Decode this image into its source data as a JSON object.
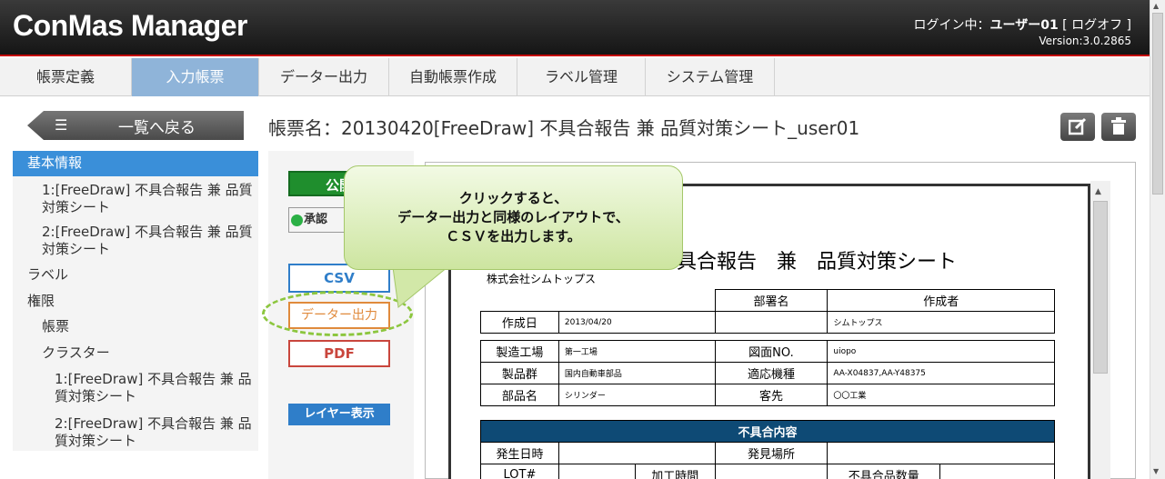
{
  "app": {
    "title": "ConMas Manager",
    "login_text": "ログイン中：",
    "user": "ユーザー01",
    "logout": "[ ログオフ ]",
    "version": "Version:3.0.2865"
  },
  "tabs": [
    "帳票定義",
    "入力帳票",
    "データー出力",
    "自動帳票作成",
    "ラベル管理",
    "システム管理"
  ],
  "back_label": "一覧へ戻る",
  "form_title": "帳票名：20130420[FreeDraw] 不具合報告 兼 品質対策シート_user01",
  "sidebar": {
    "basic": "基本情報",
    "sheet1": [
      "1:[FreeDraw] 不具合報告 兼 品質",
      "対策シート"
    ],
    "sheet2": [
      "2:[FreeDraw] 不具合報告 兼 品質",
      "対策シート"
    ],
    "label": "ラベル",
    "permission": "権限",
    "form": "帳票",
    "cluster": "クラスター",
    "c_sheet1": [
      "1:[FreeDraw] 不具合報告 兼 品",
      "質対策シート"
    ],
    "c_sheet2": [
      "2:[FreeDraw] 不具合報告 兼 品",
      "質対策シート"
    ]
  },
  "buttons": {
    "publish": "公開",
    "approve": "承認",
    "csv": "CSV",
    "data_output": "データー出力",
    "pdf": "PDF",
    "layer": "レイヤー表示"
  },
  "callout": [
    "クリックすると、",
    "データー出力と同様のレイアウトで、",
    "ＣＳＶを出力します。"
  ],
  "document": {
    "title": "不具合報告　兼　品質対策シート",
    "company": "株式会社シムトップス",
    "dept_label": "部署名",
    "author_label": "作成者",
    "date_label": "作成日",
    "date_value": "2013/04/20",
    "author_value": "シムトップス",
    "factory_label": "製造工場",
    "factory_value": "第一工場",
    "drawing_label": "図面NO.",
    "drawing_value": "uiopo",
    "group_label": "製品群",
    "group_value": "国内自動車部品",
    "model_label": "適応機種",
    "model_value": "AA-X04837,AA-Y48375",
    "part_label": "部品名",
    "part_value": "シリンダー",
    "customer_label": "客先",
    "customer_value": "〇〇工業",
    "defect_header": "不具合内容",
    "occur_label": "発生日時",
    "place_label": "発見場所",
    "lot_label": "LOT#",
    "process_label": "加工時間",
    "defect_qty_label": "不具合品数量"
  },
  "colors": {
    "header": "#222222",
    "active_tab": "#8fb4d9",
    "sidebar_active": "#3a8fd9",
    "callout": "#cde5a0",
    "doc_band": "#0e4a75"
  }
}
